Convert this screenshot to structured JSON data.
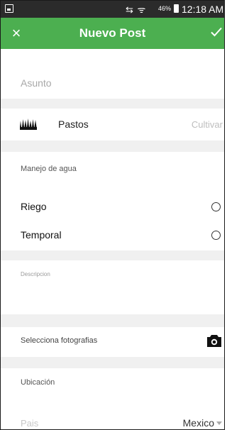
{
  "status_bar": {
    "icons": "⇆ ᯤ",
    "battery_percent": "46%",
    "time": "12:18 AM"
  },
  "app_bar": {
    "close_label": "×",
    "title": "Nuevo Post",
    "color": "#4caf50"
  },
  "form": {
    "subject": {
      "placeholder": "Asunto",
      "value": ""
    },
    "crop": {
      "name": "Pastos",
      "action_label": "Cultivar",
      "icon": "grass-icon"
    },
    "water_management": {
      "label": "Manejo de agua",
      "options": [
        {
          "label": "Riego",
          "selected": false
        },
        {
          "label": "Temporal",
          "selected": false
        }
      ]
    },
    "description": {
      "label": "Descripcion",
      "value": ""
    },
    "photos": {
      "label": "Selecciona fotografias",
      "icon": "camera-icon"
    },
    "location": {
      "label": "Ubicación",
      "country_label": "Pais",
      "country_value": "Mexico"
    }
  }
}
